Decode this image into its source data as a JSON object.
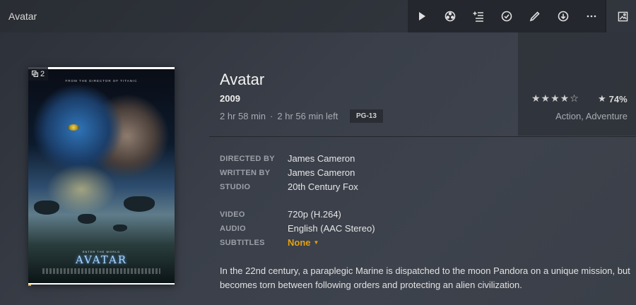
{
  "window": {
    "title": "Avatar"
  },
  "toolbar": {
    "buttons": [
      {
        "name": "play",
        "icon": "play-icon"
      },
      {
        "name": "trailer",
        "icon": "film-reel-icon"
      },
      {
        "name": "add-to-playlist",
        "icon": "add-list-icon"
      },
      {
        "name": "mark-watched",
        "icon": "check-circle-icon"
      },
      {
        "name": "edit",
        "icon": "pencil-icon"
      },
      {
        "name": "download",
        "icon": "download-icon"
      },
      {
        "name": "more",
        "icon": "more-icon"
      }
    ],
    "artwork_icon": "image-icon"
  },
  "poster": {
    "badge_count": "2",
    "top_text": "FROM THE DIRECTOR OF TITANIC",
    "sub_text": "ENTER THE WORLD",
    "name_text": "AVATAR",
    "progress_fraction": 0.02
  },
  "movie": {
    "title": "Avatar",
    "year": "2009",
    "duration": "2 hr 58 min",
    "separator": "·",
    "time_left": "2 hr 56 min left",
    "content_rating": "PG-13",
    "stars_display": "★★★★☆",
    "star_rating": 4,
    "audience_icon": "★",
    "audience_score": "74%",
    "genres": "Action, Adventure"
  },
  "details": {
    "directed_by_label": "DIRECTED BY",
    "directed_by": "James Cameron",
    "written_by_label": "WRITTEN BY",
    "written_by": "James Cameron",
    "studio_label": "STUDIO",
    "studio": "20th Century Fox",
    "video_label": "VIDEO",
    "video": "720p (H.264)",
    "audio_label": "AUDIO",
    "audio": "English (AAC Stereo)",
    "subtitles_label": "SUBTITLES",
    "subtitles": "None",
    "subtitles_caret": "▼"
  },
  "summary": "In the 22nd century, a paraplegic Marine is dispatched to the moon Pandora on a unique mission, but becomes torn between following orders and protecting an alien civilization.",
  "colors": {
    "accent": "#e5a00d",
    "toolbar_bg": "#24272d"
  }
}
